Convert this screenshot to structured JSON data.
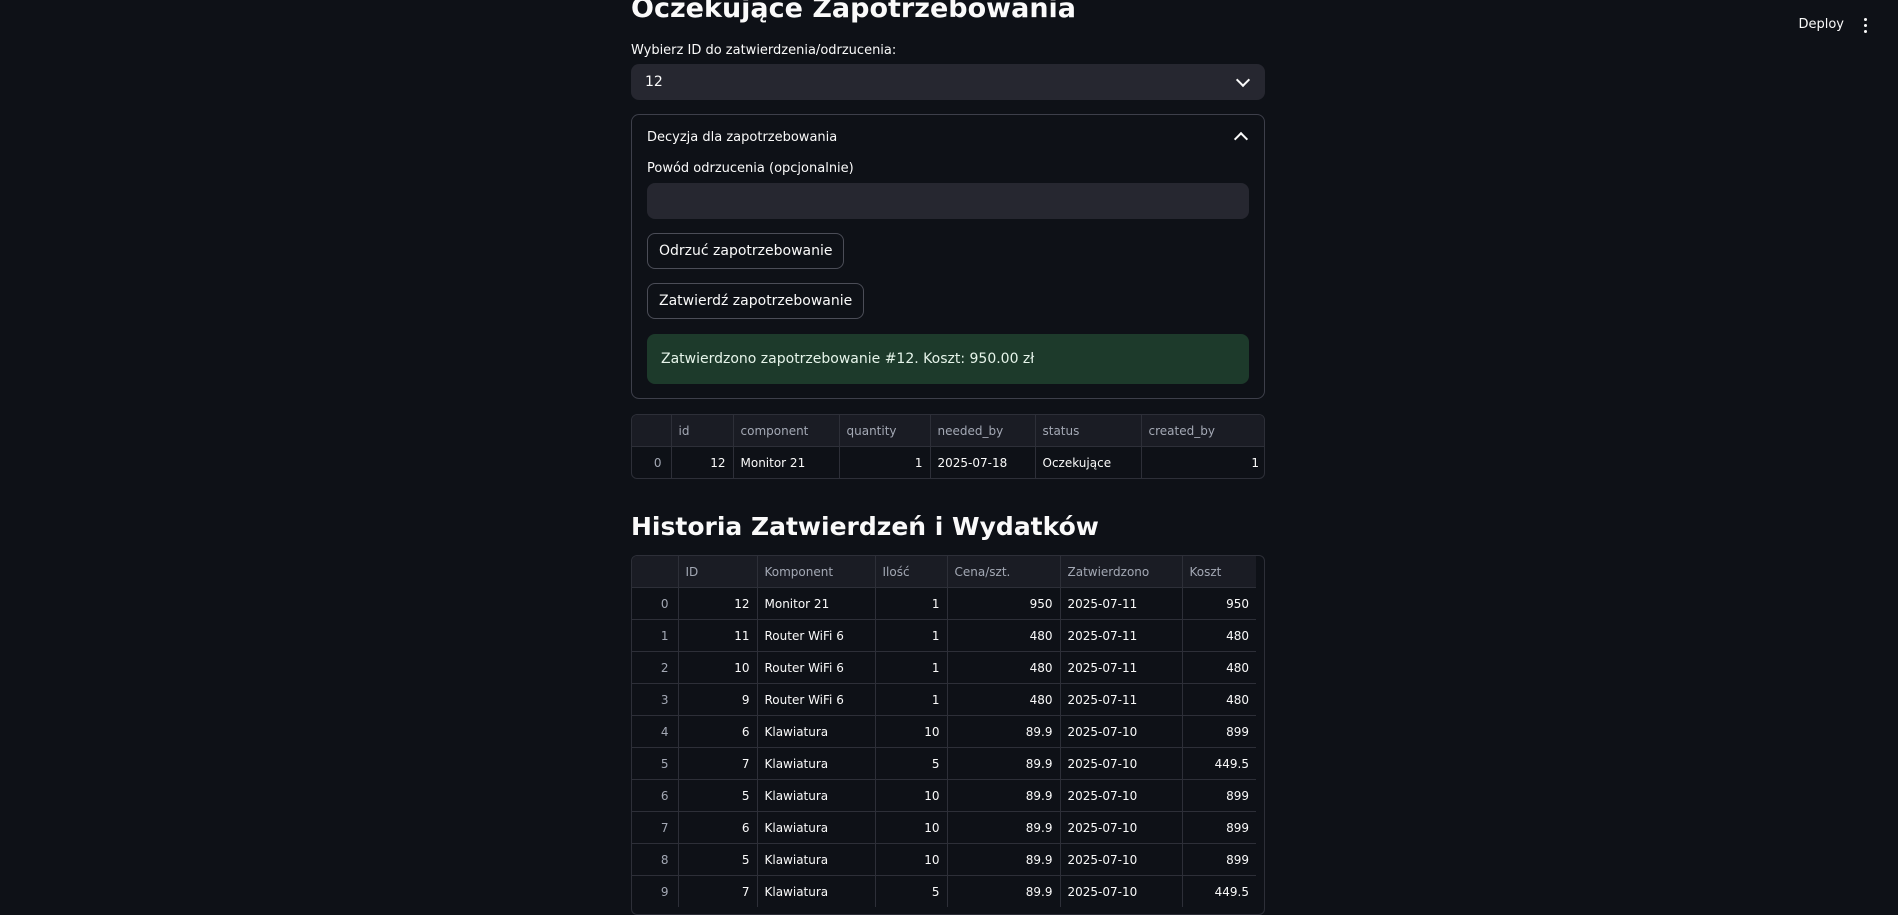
{
  "topbar": {
    "deploy_label": "Deploy"
  },
  "pending": {
    "title": "Oczekujące Zapotrzebowania",
    "select_label": "Wybierz ID do zatwierdzenia/odrzucenia:",
    "select_value": "12"
  },
  "decision": {
    "header": "Decyzja dla zapotrzebowania",
    "reason_label": "Powód odrzucenia (opcjonalnie)",
    "reason_value": "",
    "reject_button": "Odrzuć zapotrzebowanie",
    "approve_button": "Zatwierdź zapotrzebowanie",
    "success_message": "Zatwierdzono zapotrzebowanie #12. Koszt: 950.00 zł"
  },
  "pending_table": {
    "columns": [
      "",
      "id",
      "component",
      "quantity",
      "needed_by",
      "status",
      "created_by"
    ],
    "rows": [
      [
        "0",
        "12",
        "Monitor 21",
        "1",
        "2025-07-18",
        "Oczekujące",
        "1"
      ]
    ]
  },
  "history": {
    "title": "Historia Zatwierdzeń i Wydatków",
    "columns": [
      "",
      "ID",
      "Komponent",
      "Ilość",
      "Cena/szt.",
      "Zatwierdzono",
      "Koszt"
    ],
    "rows": [
      [
        "0",
        "12",
        "Monitor 21",
        "1",
        "950",
        "2025-07-11",
        "950"
      ],
      [
        "1",
        "11",
        "Router WiFi 6",
        "1",
        "480",
        "2025-07-11",
        "480"
      ],
      [
        "2",
        "10",
        "Router WiFi 6",
        "1",
        "480",
        "2025-07-11",
        "480"
      ],
      [
        "3",
        "9",
        "Router WiFi 6",
        "1",
        "480",
        "2025-07-11",
        "480"
      ],
      [
        "4",
        "6",
        "Klawiatura",
        "10",
        "89.9",
        "2025-07-10",
        "899"
      ],
      [
        "5",
        "7",
        "Klawiatura",
        "5",
        "89.9",
        "2025-07-10",
        "449.5"
      ],
      [
        "6",
        "5",
        "Klawiatura",
        "10",
        "89.9",
        "2025-07-10",
        "899"
      ],
      [
        "7",
        "6",
        "Klawiatura",
        "10",
        "89.9",
        "2025-07-10",
        "899"
      ],
      [
        "8",
        "5",
        "Klawiatura",
        "10",
        "89.9",
        "2025-07-10",
        "899"
      ],
      [
        "9",
        "7",
        "Klawiatura",
        "5",
        "89.9",
        "2025-07-10",
        "449.5"
      ]
    ]
  }
}
